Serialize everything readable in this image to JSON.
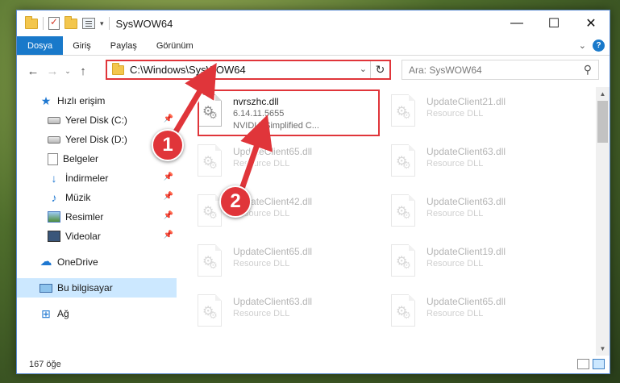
{
  "window": {
    "title": "SysWOW64",
    "controls": {
      "minimize": "—",
      "maximize": "☐",
      "close": "✕"
    }
  },
  "ribbon": {
    "tabs": [
      "Dosya",
      "Giriş",
      "Paylaş",
      "Görünüm"
    ]
  },
  "address": {
    "path": "C:\\Windows\\SysWOW64"
  },
  "search": {
    "placeholder": "Ara: SysWOW64"
  },
  "sidebar": {
    "quick_access": "Hızlı erişim",
    "items": [
      {
        "label": "Yerel Disk (C:)",
        "icon": "drive-icon",
        "pinned": true
      },
      {
        "label": "Yerel Disk (D:)",
        "icon": "drive-icon",
        "pinned": false
      },
      {
        "label": "Belgeler",
        "icon": "documents-icon",
        "pinned": true
      },
      {
        "label": "İndirmeler",
        "icon": "downloads-icon",
        "pinned": true
      },
      {
        "label": "Müzik",
        "icon": "music-icon",
        "pinned": true
      },
      {
        "label": "Resimler",
        "icon": "pictures-icon",
        "pinned": true
      },
      {
        "label": "Videolar",
        "icon": "videos-icon",
        "pinned": true
      }
    ],
    "onedrive": "OneDrive",
    "this_pc": "Bu bilgisayar",
    "network": "Ağ"
  },
  "files": [
    {
      "name": "nvrszhc.dll",
      "line2": "6.14.11.5655",
      "line3": "NVIDIA Simplified C...",
      "faded": false
    },
    {
      "name": "UpdateClient21.dll",
      "line2": "Resource DLL",
      "line3": "",
      "faded": true
    },
    {
      "name": "UpdateClient65.dll",
      "line2": "Resource DLL",
      "line3": "",
      "faded": true
    },
    {
      "name": "UpdateClient63.dll",
      "line2": "Resource DLL",
      "line3": "",
      "faded": true
    },
    {
      "name": "UpdateClient42.dll",
      "line2": "Resource DLL",
      "line3": "",
      "faded": true
    },
    {
      "name": "UpdateClient63.dll",
      "line2": "Resource DLL",
      "line3": "",
      "faded": true
    },
    {
      "name": "UpdateClient65.dll",
      "line2": "Resource DLL",
      "line3": "",
      "faded": true
    },
    {
      "name": "UpdateClient19.dll",
      "line2": "Resource DLL",
      "line3": "",
      "faded": true
    },
    {
      "name": "UpdateClient63.dll",
      "line2": "Resource DLL",
      "line3": "",
      "faded": true
    },
    {
      "name": "UpdateClient65.dll",
      "line2": "Resource DLL",
      "line3": "",
      "faded": true
    }
  ],
  "status": {
    "count": "167 öğe"
  },
  "annotations": {
    "badge1": "1",
    "badge2": "2",
    "color": "#e0353a"
  }
}
